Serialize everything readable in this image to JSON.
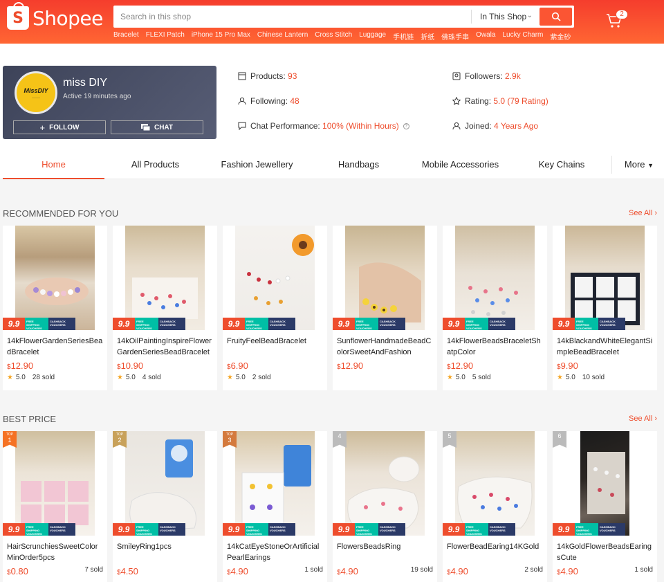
{
  "header": {
    "logo_text": "Shopee",
    "search_placeholder": "Search in this shop",
    "scope_label": "In This Shop",
    "hints": [
      "Bracelet",
      "FLEXI Patch",
      "iPhone 15 Pro Max",
      "Chinese Lantern",
      "Cross Stitch",
      "Luggage",
      "手机链",
      "折纸",
      "佛珠手串",
      "Owala",
      "Lucky Charm",
      "紫金砂"
    ],
    "cart_count": "2"
  },
  "shop": {
    "name": "miss DIY",
    "active": "Active 19 minutes ago",
    "avatar_text": "MissDIY",
    "follow_label": "FOLLOW",
    "chat_label": "CHAT",
    "stats": {
      "products_label": "Products: ",
      "products_value": "93",
      "following_label": "Following: ",
      "following_value": "48",
      "chat_label": "Chat Performance: ",
      "chat_value": "100% (Within Hours)",
      "followers_label": "Followers: ",
      "followers_value": "2.9k",
      "rating_label": "Rating: ",
      "rating_value": "5.0 (79 Rating)",
      "joined_label": "Joined: ",
      "joined_value": "4 Years Ago"
    }
  },
  "tabs": [
    "Home",
    "All Products",
    "Fashion Jewellery",
    "Handbags",
    "Mobile Accessories",
    "Key Chains",
    "More"
  ],
  "promo": {
    "sale": "9.9",
    "ship": "FREE SHIPPING VOUCHERS",
    "cash": "CASHBACK VOUCHERS",
    "currency": "$",
    "top": "TOP"
  },
  "recommended": {
    "title": "RECOMMENDED FOR YOU",
    "see_all": "See All",
    "items": [
      {
        "name": "14kFlowerGardenSeriesBeadBracelet",
        "price": "12.90",
        "rating": "5.0",
        "sold": "28 sold"
      },
      {
        "name": "14kOilPaintingInspireFlowerGardenSeriesBeadBracelet",
        "price": "10.90",
        "rating": "5.0",
        "sold": "4 sold"
      },
      {
        "name": "FruityFeelBeadBracelet",
        "price": "6.90",
        "rating": "5.0",
        "sold": "2 sold"
      },
      {
        "name": "SunflowerHandmadeBeadColorSweetAndFashion",
        "price": "12.90",
        "rating": "",
        "sold": ""
      },
      {
        "name": "14kFlowerBeadsBraceletShatpColor",
        "price": "12.90",
        "rating": "5.0",
        "sold": "5 sold"
      },
      {
        "name": "14kBlackandWhiteElegantSimpleBeadBracelet",
        "price": "9.90",
        "rating": "5.0",
        "sold": "10 sold"
      }
    ]
  },
  "best_price": {
    "title": "BEST PRICE",
    "see_all": "See All",
    "items": [
      {
        "rank": "1",
        "name": "HairScrunchiesSweetColorMinOrder5pcs",
        "price": "0.80",
        "sold": "7 sold"
      },
      {
        "rank": "2",
        "name": "SmileyRing1pcs",
        "price": "4.50",
        "sold": ""
      },
      {
        "rank": "3",
        "name": "14kCatEyeStoneOrArtificialPearlEarings",
        "price": "4.90",
        "sold": "1 sold"
      },
      {
        "rank": "4",
        "name": "FlowersBeadsRing",
        "price": "4.90",
        "sold": "19 sold"
      },
      {
        "rank": "5",
        "name": "FlowerBeadEaring14KGold",
        "price": "4.90",
        "sold": "2 sold"
      },
      {
        "rank": "6",
        "name": "14kGoldFlowerBeadsEaringsCute",
        "price": "4.90",
        "sold": "1 sold"
      }
    ]
  },
  "colors": {
    "brand": "#ee4d2d",
    "shop_card": "#4a5068",
    "star": "#f5a623"
  }
}
